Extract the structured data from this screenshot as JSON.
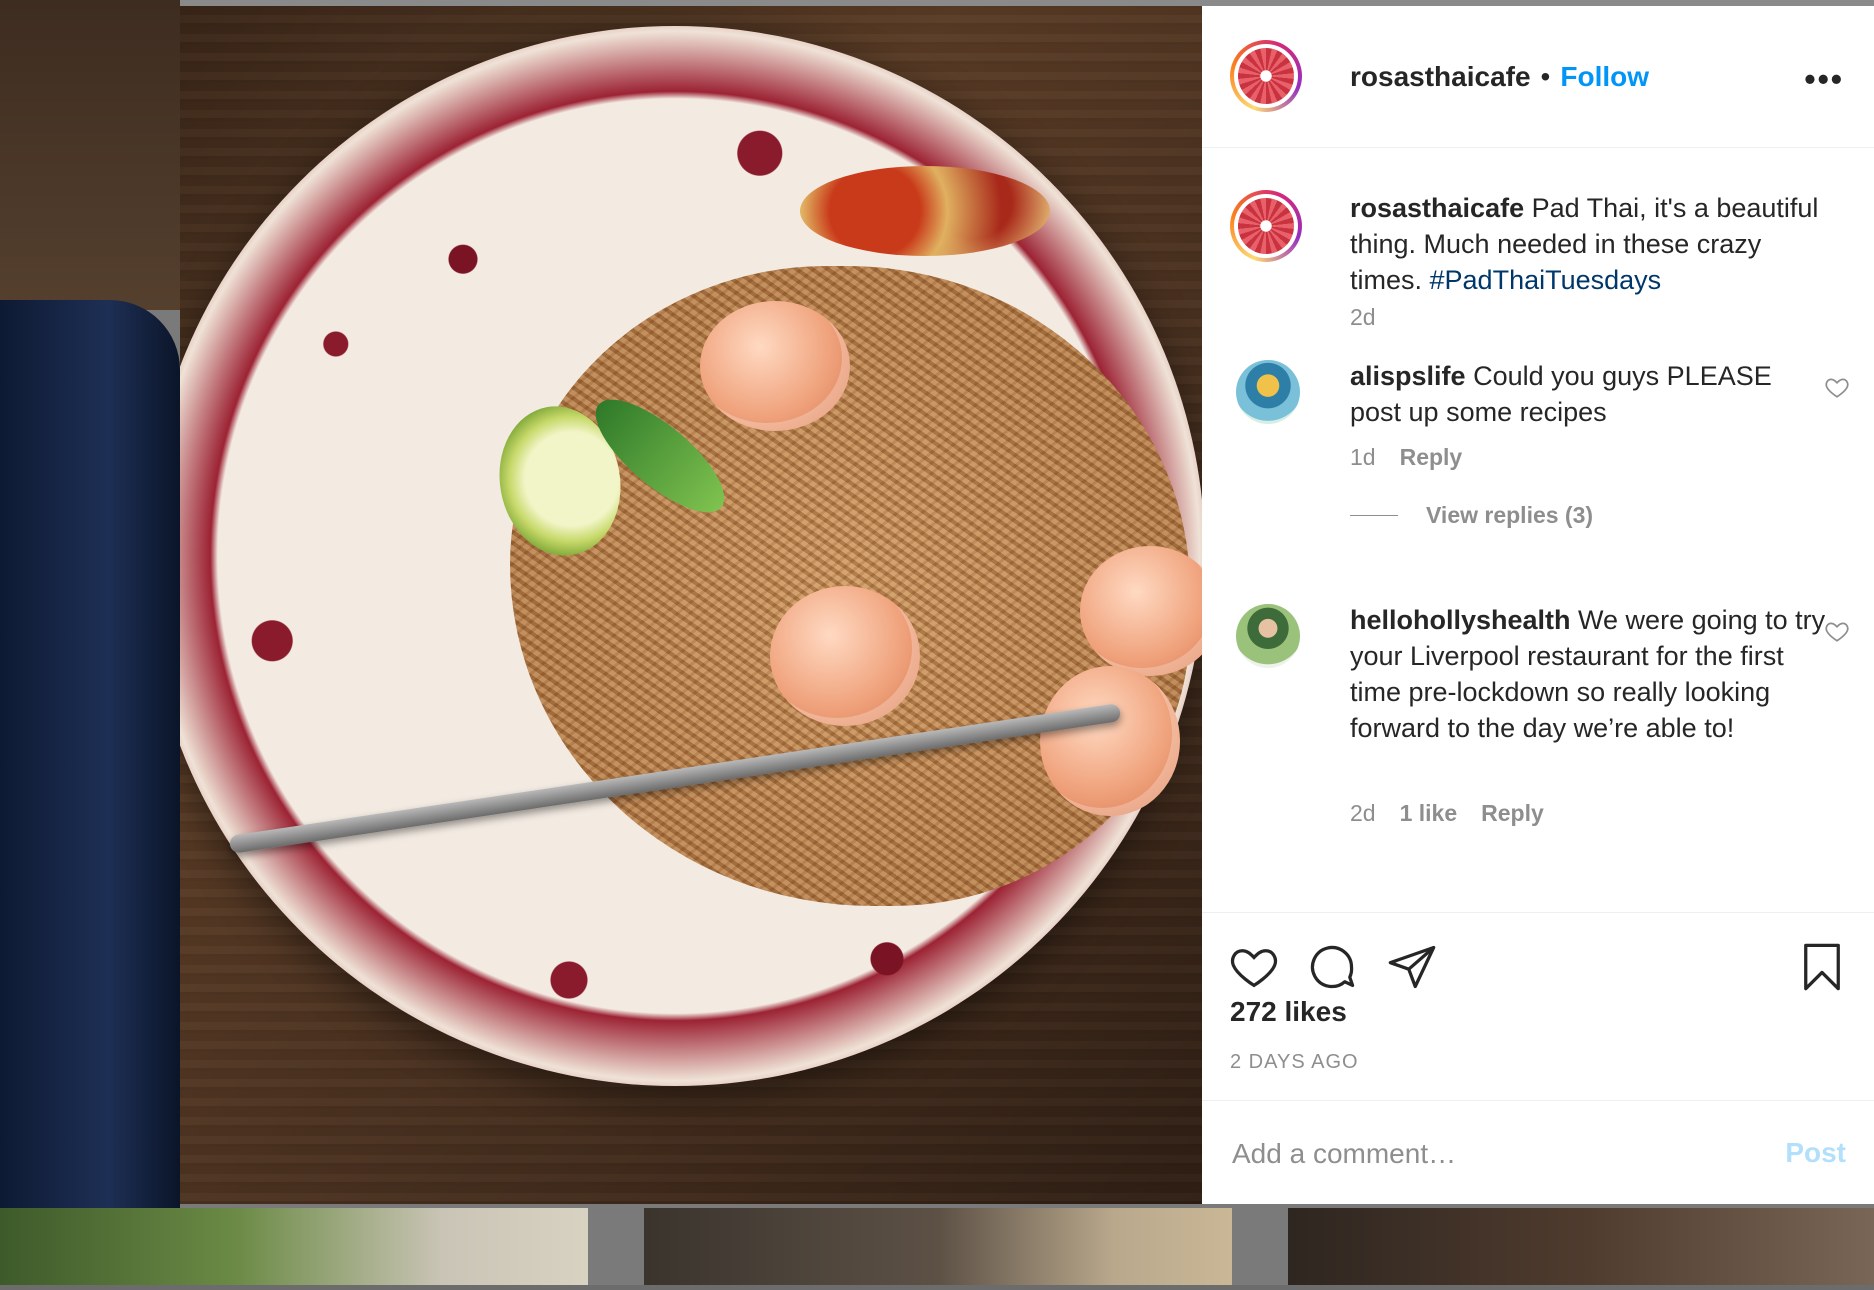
{
  "post": {
    "username": "rosasthaicafe",
    "separator": "•",
    "follow_label": "Follow",
    "more_label": "•••"
  },
  "caption": {
    "username": "rosasthaicafe",
    "text": " Pad Thai, it's a beautiful thing. Much needed in these crazy times. ",
    "hashtag": "#PadThaiTuesdays",
    "time": "2d"
  },
  "comments": [
    {
      "username": "alispslife",
      "text": " Could you guys PLEASE post up some recipes",
      "time": "1d",
      "likes": "",
      "reply_label": "Reply",
      "view_replies": "View replies (3)"
    },
    {
      "username": "hellohollyshealth",
      "text": " We were going to try your Liverpool restaurant for the first time pre-lockdown so really looking forward to the day we’re able to!",
      "time": "2d",
      "likes": "1 like",
      "reply_label": "Reply"
    }
  ],
  "stats": {
    "likes": "272 likes",
    "posted": "2 DAYS AGO"
  },
  "composer": {
    "placeholder": "Add a comment…",
    "post_label": "Post"
  },
  "colors": {
    "accent": "#0095f6",
    "hashtag": "#00376b",
    "muted": "#8e8e8e",
    "post_disabled": "#b2dffc"
  },
  "icons": [
    "heart-icon",
    "comment-icon",
    "share-icon",
    "bookmark-icon",
    "more-options-icon"
  ]
}
